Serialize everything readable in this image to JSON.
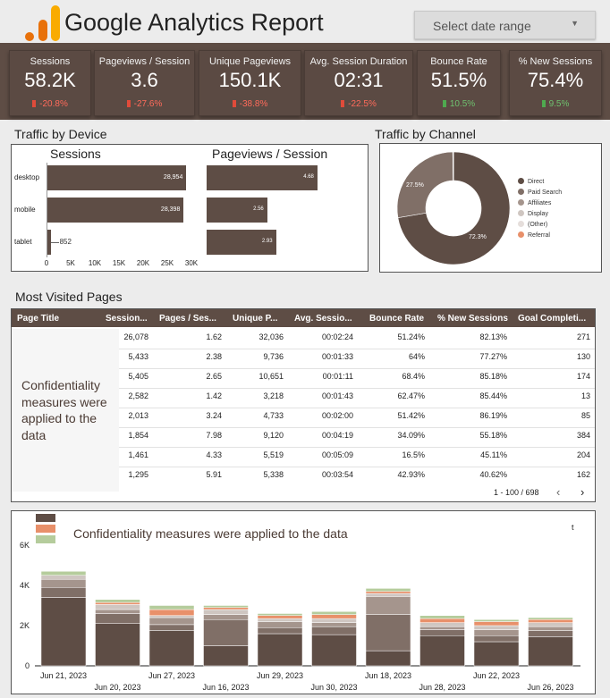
{
  "header": {
    "title": "Google Analytics Report",
    "date_range_placeholder": "Select date range"
  },
  "kpis": [
    {
      "label": "Sessions",
      "value": "58.2K",
      "delta": "-20.8%",
      "direction": "down"
    },
    {
      "label": "Pageviews / Session",
      "value": "3.6",
      "delta": "-27.6%",
      "direction": "down"
    },
    {
      "label": "Unique Pageviews",
      "value": "150.1K",
      "delta": "-38.8%",
      "direction": "down"
    },
    {
      "label": "Avg. Session Duration",
      "value": "02:31",
      "delta": "-22.5%",
      "direction": "down"
    },
    {
      "label": "Bounce Rate",
      "value": "51.5%",
      "delta": "10.5%",
      "direction": "up"
    },
    {
      "label": "% New Sessions",
      "value": "75.4%",
      "delta": "9.5%",
      "direction": "up"
    }
  ],
  "device_section": {
    "title": "Traffic by Device",
    "sessions_title": "Sessions",
    "pps_title": "Pageviews / Session"
  },
  "channel_section": {
    "title": "Traffic by Channel"
  },
  "pages_section": {
    "title": "Most Visited Pages",
    "columns": [
      "Page Title",
      "Session...",
      "Pages / Ses...",
      "Unique P...",
      "Avg. Sessio...",
      "Bounce Rate",
      "% New Sessions",
      "Goal Completi..."
    ],
    "rows": [
      [
        "26,078",
        "1.62",
        "32,036",
        "00:02:24",
        "51.24%",
        "82.13%",
        "271"
      ],
      [
        "5,433",
        "2.38",
        "9,736",
        "00:01:33",
        "64%",
        "77.27%",
        "130"
      ],
      [
        "5,405",
        "2.65",
        "10,651",
        "00:01:11",
        "68.4%",
        "85.18%",
        "174"
      ],
      [
        "2,582",
        "1.42",
        "3,218",
        "00:01:43",
        "62.47%",
        "85.44%",
        "13"
      ],
      [
        "2,013",
        "3.24",
        "4,733",
        "00:02:00",
        "51.42%",
        "86.19%",
        "85"
      ],
      [
        "1,854",
        "7.98",
        "9,120",
        "00:04:19",
        "34.09%",
        "55.18%",
        "384"
      ],
      [
        "1,461",
        "4.33",
        "5,519",
        "00:05:09",
        "16.5%",
        "45.11%",
        "204"
      ],
      [
        "1,295",
        "5.91",
        "5,338",
        "00:03:54",
        "42.93%",
        "40.62%",
        "162"
      ]
    ],
    "confidentiality_note": "Confidentiality measures were applied to the data",
    "pagination": "1 - 100 / 698",
    "prev_icon": "‹",
    "next_icon": "›"
  },
  "daily_chart": {
    "confidentiality_note": "Confidentiality measures were applied to the data",
    "stray_legend_char": "t"
  },
  "colors": {
    "brand_brown": "#5e4d45",
    "series": [
      "#5e4d45",
      "#806f67",
      "#a5958d",
      "#cfc6c1",
      "#e8906a",
      "#b5cc9c"
    ],
    "delta_down": "#e04b3a",
    "delta_up": "#4faa4f"
  },
  "chart_data": [
    {
      "type": "bar",
      "orientation": "horizontal",
      "title": "Sessions",
      "categories": [
        "desktop",
        "mobile",
        "tablet"
      ],
      "values": [
        28954,
        28398,
        852
      ],
      "value_labels": [
        "28,954",
        "28,398",
        "852"
      ],
      "xlim": [
        0,
        30000
      ],
      "xticks": [
        "0",
        "5K",
        "10K",
        "15K",
        "20K",
        "25K",
        "30K"
      ]
    },
    {
      "type": "bar",
      "orientation": "horizontal",
      "title": "Pageviews / Session",
      "categories": [
        "desktop",
        "mobile",
        "tablet"
      ],
      "values": [
        4.68,
        2.56,
        2.93
      ],
      "value_labels": [
        "4.68",
        "2.56",
        "2.93"
      ],
      "xlim": [
        0,
        6.8
      ]
    },
    {
      "type": "pie",
      "donut": true,
      "legend_position": "right",
      "labels": [
        "Direct",
        "Paid Search",
        "Affiliates",
        "Display",
        "(Other)",
        "Referral"
      ],
      "values": [
        72.3,
        27.5,
        0.1,
        0.05,
        0.03,
        0.02
      ],
      "slice_labels": [
        "72.3%",
        "27.5%"
      ],
      "colors": [
        "#5e4d45",
        "#806f67",
        "#a5958d",
        "#cfc6c1",
        "#e5dedb",
        "#e8906a"
      ]
    },
    {
      "type": "bar",
      "stacked": true,
      "categories": [
        "Jun 21, 2023",
        "Jun 20, 2023",
        "Jun 27, 2023",
        "Jun 16, 2023",
        "Jun 29, 2023",
        "Jun 30, 2023",
        "Jun 18, 2023",
        "Jun 28, 2023",
        "Jun 22, 2023",
        "Jun 26, 2023"
      ],
      "ylim": [
        0,
        6000
      ],
      "yticks": [
        "0",
        "2K",
        "4K",
        "6K"
      ],
      "series": [
        {
          "values": [
            3400,
            2100,
            1750,
            1000,
            1600,
            1550,
            750,
            1500,
            1200,
            1450
          ]
        },
        {
          "values": [
            500,
            500,
            300,
            1300,
            300,
            400,
            1800,
            300,
            300,
            300
          ]
        },
        {
          "values": [
            400,
            200,
            350,
            250,
            300,
            200,
            900,
            150,
            300,
            200
          ]
        },
        {
          "values": [
            200,
            250,
            100,
            250,
            150,
            200,
            150,
            200,
            200,
            200
          ]
        },
        {
          "values": [
            0,
            100,
            300,
            100,
            150,
            200,
            100,
            200,
            200,
            150
          ]
        },
        {
          "values": [
            200,
            150,
            200,
            100,
            100,
            150,
            150,
            150,
            100,
            100
          ]
        }
      ]
    }
  ]
}
